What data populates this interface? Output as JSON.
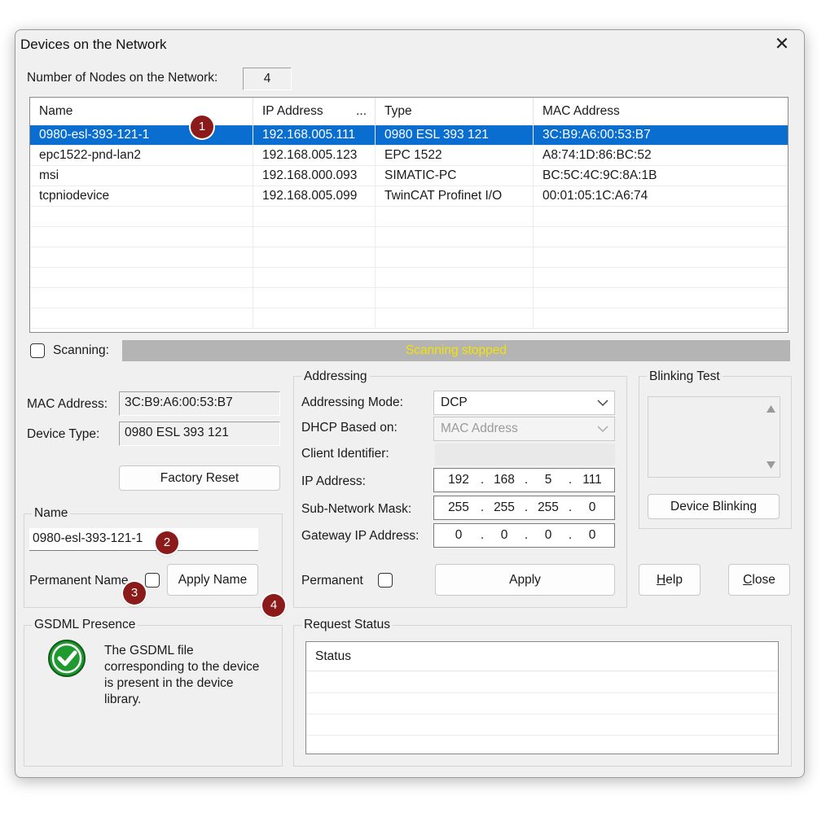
{
  "window": {
    "title": "Devices on the Network",
    "close_symbol": "✕"
  },
  "nodes": {
    "label": "Number of Nodes on the Network:",
    "count": "4"
  },
  "device_list": {
    "columns": [
      "Name",
      "IP Address",
      "...",
      "Type",
      "MAC Address"
    ],
    "rows": [
      {
        "name": "0980-esl-393-121-1",
        "ip": "192.168.005.111",
        "type": "0980 ESL 393 121",
        "mac": "3C:B9:A6:00:53:B7",
        "selected": true
      },
      {
        "name": "epc1522-pnd-lan2",
        "ip": "192.168.005.123",
        "type": "EPC 1522",
        "mac": "A8:74:1D:86:BC:52",
        "selected": false
      },
      {
        "name": "msi",
        "ip": "192.168.000.093",
        "type": "SIMATIC-PC",
        "mac": "BC:5C:4C:9C:8A:1B",
        "selected": false
      },
      {
        "name": "tcpniodevice",
        "ip": "192.168.005.099",
        "type": "TwinCAT Profinet I/O",
        "mac": "00:01:05:1C:A6:74",
        "selected": false
      }
    ]
  },
  "scanning": {
    "label": "Scanning:",
    "status": "Scanning stopped",
    "checked": false,
    "status_color": "#f4e200"
  },
  "device_info": {
    "mac_label": "MAC Address:",
    "mac_value": "3C:B9:A6:00:53:B7",
    "type_label": "Device Type:",
    "type_value": "0980 ESL 393 121",
    "factory_reset": "Factory Reset"
  },
  "name_group": {
    "title": "Name",
    "value": "0980-esl-393-121-1",
    "permanent_label": "Permanent Name",
    "apply_button": "Apply Name"
  },
  "addressing": {
    "title": "Addressing",
    "mode_label": "Addressing Mode:",
    "mode_value": "DCP",
    "dhcp_label": "DHCP Based on:",
    "dhcp_value": "MAC Address",
    "client_label": "Client Identifier:",
    "client_value": "",
    "ip_label": "IP Address:",
    "ip": [
      "192",
      "168",
      "5",
      "111"
    ],
    "mask_label": "Sub-Network Mask:",
    "mask": [
      "255",
      "255",
      "255",
      "0"
    ],
    "gateway_label": "Gateway IP Address:",
    "gateway": [
      "0",
      "0",
      "0",
      "0"
    ],
    "permanent_label": "Permanent",
    "apply_button": "Apply"
  },
  "blinking": {
    "title": "Blinking Test",
    "button": "Device Blinking"
  },
  "buttons": {
    "help_mnemonic": "H",
    "help_rest": "elp",
    "close_mnemonic": "C",
    "close_rest": "lose"
  },
  "gsdml": {
    "title": "GSDML Presence",
    "text_lines": [
      "The GSDML file",
      "corresponding to the device",
      "is present in the device",
      "library."
    ]
  },
  "request_status": {
    "title": "Request Status",
    "column": "Status"
  },
  "badges": [
    "1",
    "2",
    "3",
    "4"
  ],
  "colors": {
    "selection": "#0a6ed1",
    "badge": "#8b1a1a",
    "check_green": "#1f9a2e"
  }
}
